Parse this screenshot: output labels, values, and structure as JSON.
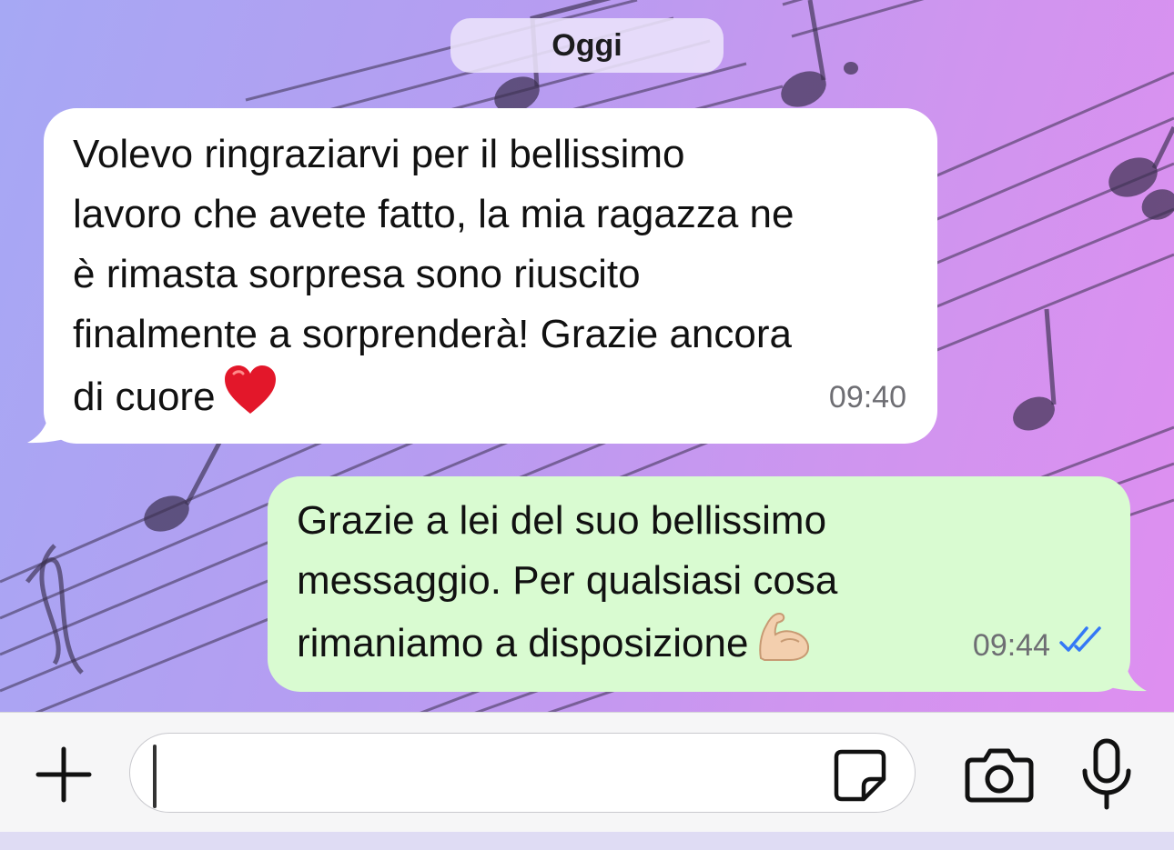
{
  "chat": {
    "date_separator": "Oggi",
    "messages": [
      {
        "direction": "incoming",
        "text": "Volevo ringraziarvi per il bellissimo\nlavoro che avete fatto, la mia ragazza ne\nè rimasta sorpresa sono riuscito\nfinalmente a sorprenderà! Grazie ancora\ndi cuore",
        "emoji": "red-heart",
        "time": "09:40"
      },
      {
        "direction": "outgoing",
        "text": "Grazie a lei del suo bellissimo\nmessaggio. Per qualsiasi cosa\nrimaniamo a disposizione",
        "emoji": "flexed-biceps",
        "time": "09:44",
        "status": "read",
        "status_icon": "double-check-icon"
      }
    ]
  },
  "input_bar": {
    "message_value": "",
    "icons": [
      "plus-icon",
      "sticker-icon",
      "camera-icon",
      "microphone-icon"
    ]
  },
  "colors": {
    "incoming_bubble": "#ffffff",
    "outgoing_bubble": "#d9fbd1",
    "read_ticks": "#3478f6",
    "wallpaper_start": "#a6a8f4",
    "wallpaper_end": "#e08ef0"
  }
}
